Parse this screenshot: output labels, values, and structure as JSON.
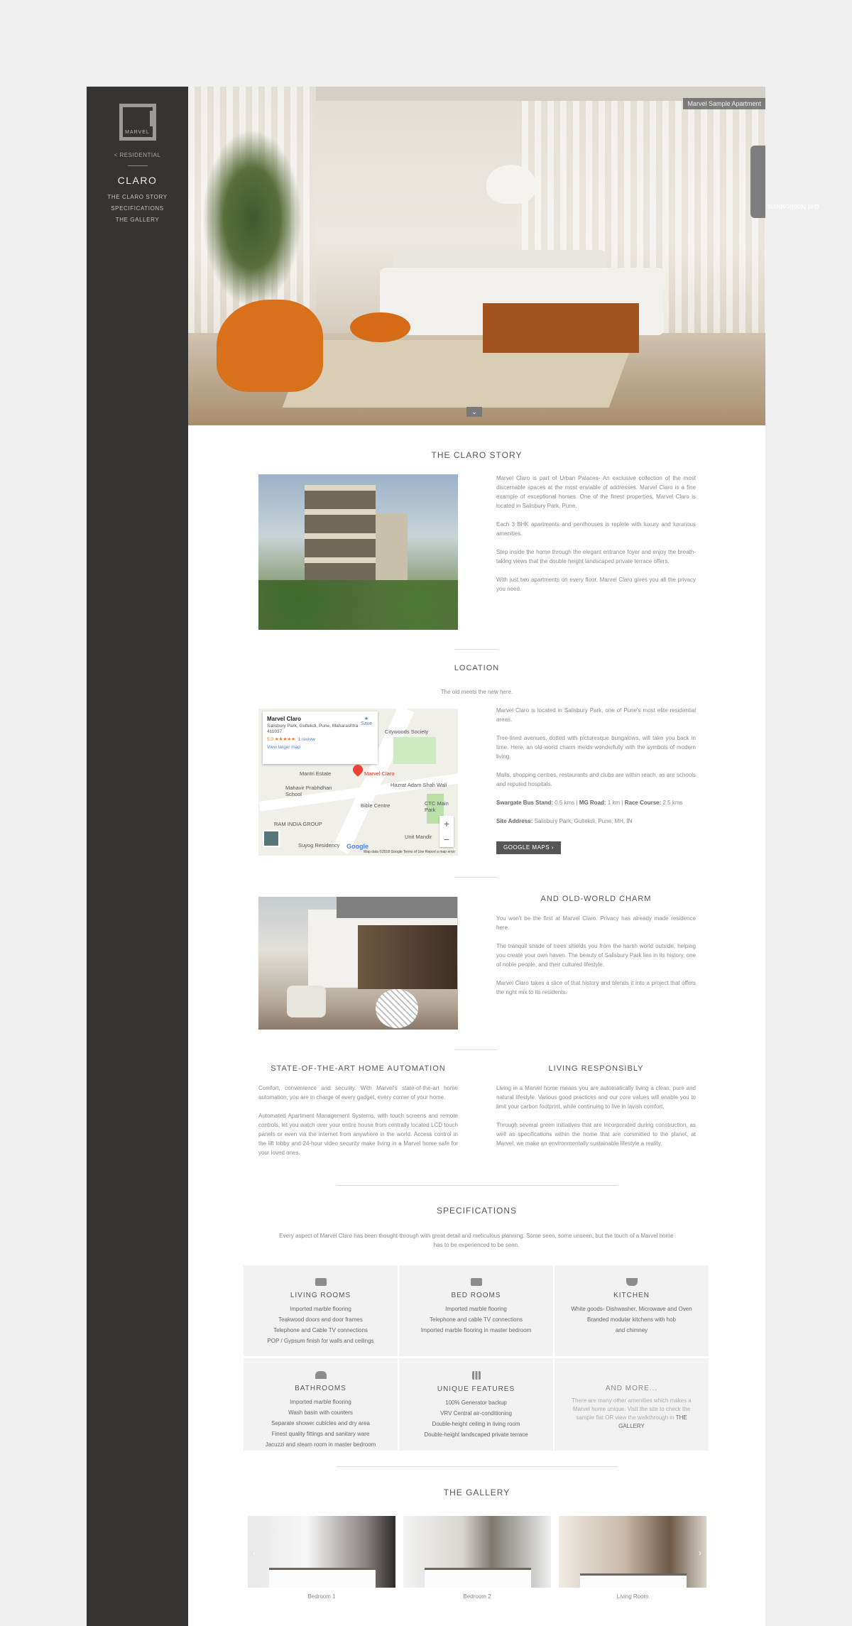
{
  "sidebar": {
    "logo_text": "MARVEL",
    "back_link": "< RESIDENTIAL",
    "title": "CLARO",
    "nav": [
      "THE CLARO STORY",
      "SPECIFICATIONS",
      "THE GALLERY"
    ]
  },
  "hero": {
    "tag": "Marvel Sample Apartment",
    "scroll_icon": "chevron-down-icon",
    "notifications_label": "Get Notifications",
    "notifications_icon": "bell-icon"
  },
  "story": {
    "title": "THE CLARO STORY",
    "paragraphs": [
      "Marvel Claro is part of Urban Palaces- An exclusive collection of the most discernable spaces at the most enviable of addresses. Marvel Claro is a fine example of exceptional homes. One of the finest properties, Marvel Claro is located in Salisbury Park, Pune.",
      "Each 3 BHK apartments and penthouses is replete with luxury and luxurious amenities.",
      "Step inside the home through the elegant entrance foyer and enjoy the breath-taking views that the double height landscaped private terrace offers.",
      "With just two apartments on every floor, Marvel Claro gives you all the privacy you need."
    ]
  },
  "location": {
    "title": "LOCATION",
    "subtitle": "The old meets the new here.",
    "map": {
      "place_name": "Marvel Claro",
      "address": "Salisbury Park, Gultekdi, Pune, Maharashtra 411037",
      "rating": "5.0 ★★★★★",
      "reviews": "1 review",
      "larger_map": "View larger map",
      "save": "Save",
      "labels": [
        "Citywoods Society",
        "Mantri Estate",
        "Marvel Claro",
        "Hazrat Adam Shah Wali",
        "Mahavir Prabhdhan School",
        "Bible Centre",
        "CTC Main Park",
        "RAM INDIA GROUP",
        "Unit Mandir",
        "Suyog Residency"
      ],
      "google": "Google",
      "footer": "Map data ©2018 Google   Terms of Use   Report a map error"
    },
    "paragraphs": [
      "Marvel Claro is located in Salisbury Park, one of Pune's most elite residential areas.",
      "Tree-lined avenues, dotted with picturesque bungalows, will take you back in time. Here, an old-world charm melds wonderfully with the symbols of modern living.",
      "Malls, shopping centres, restaurants and clubs are within reach, as are schools and reputed hospitals."
    ],
    "distances": [
      {
        "label": "Swargate Bus Stand:",
        "value": "0.5 kms"
      },
      {
        "label": "MG Road:",
        "value": "1 km"
      },
      {
        "label": "Race Course:",
        "value": "2.5 kms"
      }
    ],
    "site_address_label": "Site Address:",
    "site_address": "Salisbury Park, Gultekdi, Pune, MH, IN",
    "button": "GOOGLE MAPS  ›"
  },
  "charm": {
    "title": "AND OLD-WORLD CHARM",
    "paragraphs": [
      "You won't be the first at Marvel Claro. Privacy has already made residence here.",
      "The tranquil shade of trees shields you from the harsh world outside, helping you create your own haven. The beauty of Salisbury Park lies in its history, one of noble people, and their cultured lifestyle.",
      "Marvel Claro takes a slice of that history and blends it into a project that offers the right mix to its residents."
    ]
  },
  "automation": {
    "title": "STATE-OF-THE-ART HOME AUTOMATION",
    "paragraphs": [
      "Comfort, convenience and security. With Marvel's state-of-the-art home automation, you are in charge of every gadget, every corner of your home.",
      "Automated Apartment Management Systems, with touch screens and remote controls, let you watch over your entire house from centrally located LCD touch panels or even via the internet from anywhere in the world. Access control in the lift lobby and 24-hour video security make living in a Marvel home safe for your loved ones."
    ]
  },
  "responsibly": {
    "title": "LIVING RESPONSIBLY",
    "paragraphs": [
      "Living in a Marvel home means you are automatically living a clean, pure and natural lifestyle. Various good practices and our core values will enable you to limit your carbon footprint, while continuing to live in lavish comfort.",
      "Through several green initiatives that are incorporated during construction, as well as specifications within the home that are committed to the planet, at Marvel, we make an environmentally sustainable lifestyle a reality."
    ]
  },
  "specifications": {
    "title": "SPECIFICATIONS",
    "intro": "Every aspect of Marvel Claro has been thought-through with great detail and meticulous planning. Some seen, some unseen, but the touch of a Marvel home has to be experienced to be seen.",
    "cells": [
      {
        "icon": "sofa-icon",
        "title": "LIVING ROOMS",
        "lines": [
          "Imported marble flooring",
          "Teakwood doors and door frames",
          "Telephone and Cable TV connections",
          "POP / Gypsum finish for walls and ceilings"
        ]
      },
      {
        "icon": "bed-icon",
        "title": "BED ROOMS",
        "lines": [
          "Imported marble flooring",
          "Telephone and cable TV connections",
          "Imported marble flooring in master bedroom"
        ]
      },
      {
        "icon": "cup-icon",
        "title": "KITCHEN",
        "lines": [
          "White goods- Dishwasher, Microwave and Oven",
          "Branded modular kitchens with hob  and chimney"
        ]
      },
      {
        "icon": "shower-icon",
        "title": "BATHROOMS",
        "lines": [
          "Imported marble flooring",
          "Wash basin with counters",
          "Separate shower cubicles and dry area",
          "Finest quality fittings and sanitary ware",
          "Jacuzzi and steam room in master bedroom"
        ]
      },
      {
        "icon": "grid-icon",
        "title": "UNIQUE FEATURES",
        "lines": [
          "100% Generator backup",
          "VRV Central air-conditioning",
          "Double-height ceiling in living room",
          "Double-height landscaped private terrace"
        ]
      },
      {
        "icon": "",
        "title": "AND MORE...",
        "more_text": "There are many other amenities which makes a Marvel home unique. Visit the site to check the sample flat OR view the walkthrough in",
        "more_link": "THE GALLERY"
      }
    ]
  },
  "gallery": {
    "title": "THE GALLERY",
    "items": [
      "Bedroom 1",
      "Bedroom 2",
      "Living Room"
    ]
  },
  "colors": {
    "sidebar": "#363433",
    "background": "#efefef",
    "accent": "#555555"
  }
}
